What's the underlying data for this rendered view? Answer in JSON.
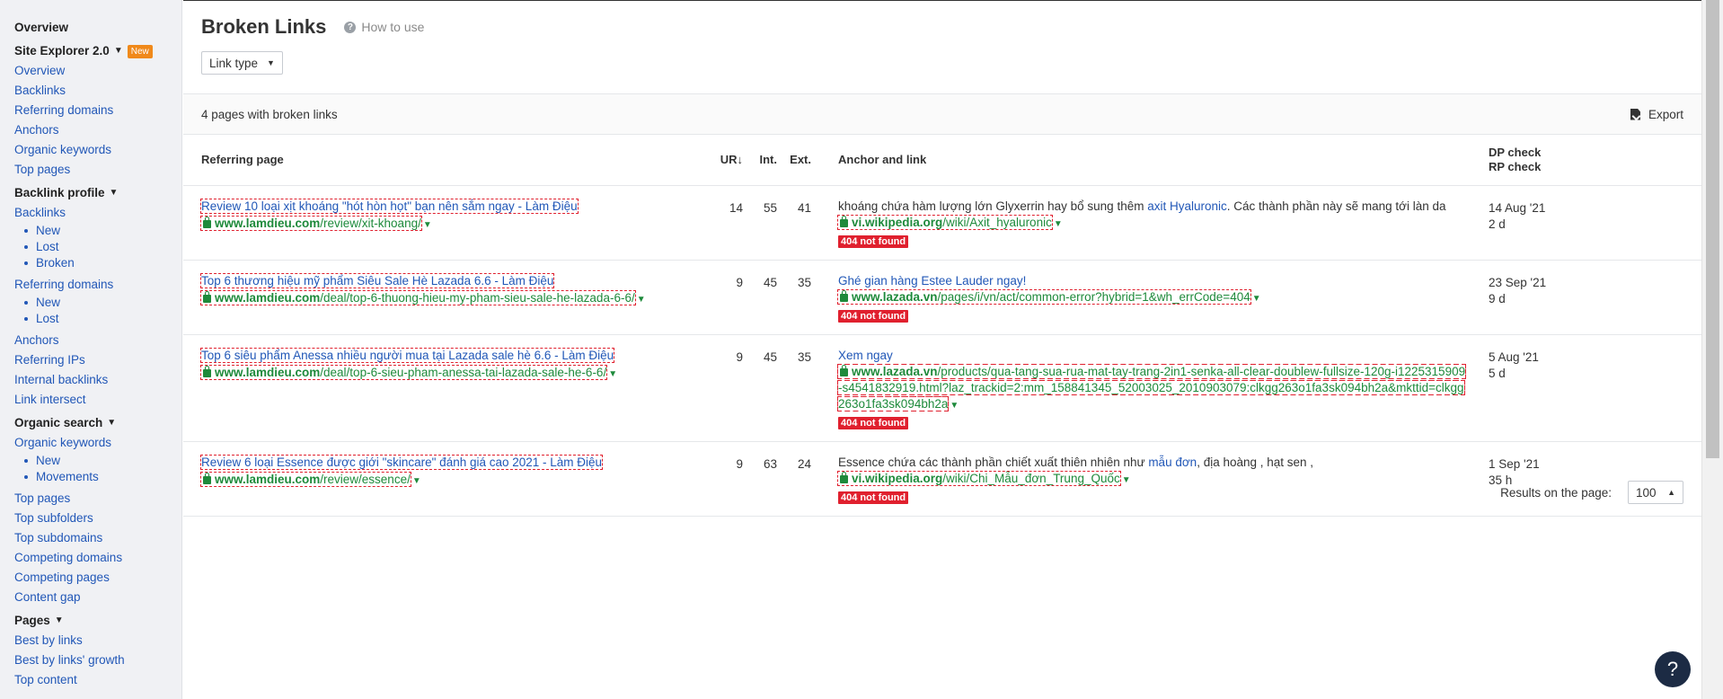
{
  "sidebar": {
    "overview": "Overview",
    "site_explorer": {
      "label": "Site Explorer 2.0",
      "badge": "New"
    },
    "se_items": [
      "Overview",
      "Backlinks",
      "Referring domains",
      "Anchors",
      "Organic keywords",
      "Top pages"
    ],
    "backlink_profile": "Backlink profile",
    "bp_backlinks": "Backlinks",
    "bp_backlinks_sub": [
      "New",
      "Lost",
      "Broken"
    ],
    "bp_refdomains": "Referring domains",
    "bp_refdomains_sub": [
      "New",
      "Lost"
    ],
    "bp_items": [
      "Anchors",
      "Referring IPs",
      "Internal backlinks",
      "Link intersect"
    ],
    "organic_search": "Organic search",
    "os_keywords": "Organic keywords",
    "os_keywords_sub": [
      "New",
      "Movements"
    ],
    "os_items": [
      "Top pages",
      "Top subfolders",
      "Top subdomains",
      "Competing domains",
      "Competing pages",
      "Content gap"
    ],
    "pages": "Pages",
    "pages_items": [
      "Best by links",
      "Best by links' growth",
      "Top content"
    ]
  },
  "header": {
    "title": "Broken Links",
    "how_to_use": "How to use",
    "link_type": "Link type"
  },
  "summary": {
    "count_text": "4 pages with broken links",
    "export": "Export"
  },
  "table": {
    "headers": {
      "referring_page": "Referring page",
      "ur": "UR",
      "ur_sort": "↓",
      "int": "Int.",
      "ext": "Ext.",
      "anchor": "Anchor and link",
      "dp_check": "DP check",
      "rp_check": "RP check"
    },
    "rows": [
      {
        "title": "Review 10 loại xịt khoáng \"hót hòn họt\" bạn nên sắm ngay - Làm Điệu",
        "url_domain": "www.lamdieu.com",
        "url_path": "/review/xit-khoang/",
        "ur": "14",
        "int": "55",
        "ext": "41",
        "anchor_pre": "khoáng chứa hàm lượng lớn Glyxerrin hay bổ sung thêm ",
        "anchor_link": "axit Hyaluronic",
        "anchor_post": ". Các thành phần này sẽ mang tới làn da",
        "link_domain": "vi.wikipedia.org",
        "link_path": "/wiki/Axit_hyaluronic",
        "error": "404 not found",
        "dp": "14 Aug '21",
        "rp": "2 d"
      },
      {
        "title": "Top 6 thương hiệu mỹ phẩm Siêu Sale Hè Lazada 6.6 - Làm Điệu",
        "url_domain": "www.lamdieu.com",
        "url_path": "/deal/top-6-thuong-hieu-my-pham-sieu-sale-he-lazada-6-6/",
        "ur": "9",
        "int": "45",
        "ext": "35",
        "anchor_pre": "",
        "anchor_link": "Ghé gian hàng Estee Lauder ngay!",
        "anchor_post": "",
        "link_domain": "www.lazada.vn",
        "link_path": "/pages/i/vn/act/common-error?hybrid=1&wh_errCode=404",
        "error": "404 not found",
        "dp": "23 Sep '21",
        "rp": "9 d"
      },
      {
        "title": "Top 6 siêu phẩm Anessa nhiều người mua tại Lazada sale hè 6.6 - Làm Điệu",
        "url_domain": "www.lamdieu.com",
        "url_path": "/deal/top-6-sieu-pham-anessa-tai-lazada-sale-he-6-6/",
        "ur": "9",
        "int": "45",
        "ext": "35",
        "anchor_pre": "",
        "anchor_link": "Xem ngay",
        "anchor_post": "",
        "link_domain": "www.lazada.vn",
        "link_path": "/products/qua-tang-sua-rua-mat-tay-trang-2in1-senka-all-clear-doublew-fullsize-120g-i1225315909-s4541832919.html?laz_trackid=2:mm_158841345_52003025_2010903079:clkgg263o1fa3sk094bh2a&mkttid=clkgg263o1fa3sk094bh2a",
        "error": "404 not found",
        "dp": "5 Aug '21",
        "rp": "5 d"
      },
      {
        "title": "Review 6 loại Essence được giới \"skincare\" đánh giá cao 2021 - Làm Điệu",
        "url_domain": "www.lamdieu.com",
        "url_path": "/review/essence/",
        "ur": "9",
        "int": "63",
        "ext": "24",
        "anchor_pre": "Essence chứa các thành phần chiết xuất thiên nhiên như ",
        "anchor_link": "mẫu đơn",
        "anchor_post": ", địa hoàng , hạt sen ,",
        "link_domain": "vi.wikipedia.org",
        "link_path": "/wiki/Chi_Mẫu_đơn_Trung_Quốc",
        "error": "404 not found",
        "dp": "1 Sep '21",
        "rp": "35 h"
      }
    ]
  },
  "pagination": {
    "results_label": "Results on the page:",
    "per_page": "100"
  },
  "help": "?"
}
